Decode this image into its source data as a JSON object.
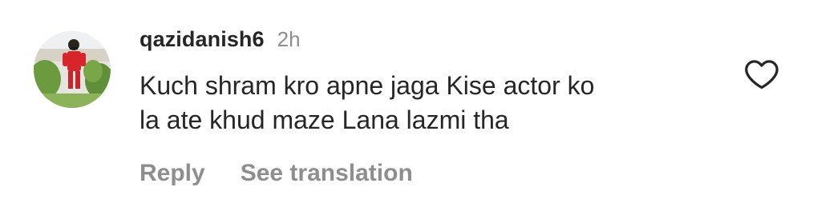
{
  "comment": {
    "username": "qazidanish6",
    "time": "2h",
    "lines": [
      "Kuch shram kro apne jaga Kise actor ko",
      "la ate khud maze Lana lazmi tha"
    ],
    "reply_label": "Reply",
    "translation_label": "See translation",
    "avatar_icon": "avatar-photo-icon",
    "like_icon": "heart-outline-icon"
  },
  "colors": {
    "primary_text": "#262626",
    "secondary_text": "#8e8e8e",
    "background": "#ffffff"
  }
}
